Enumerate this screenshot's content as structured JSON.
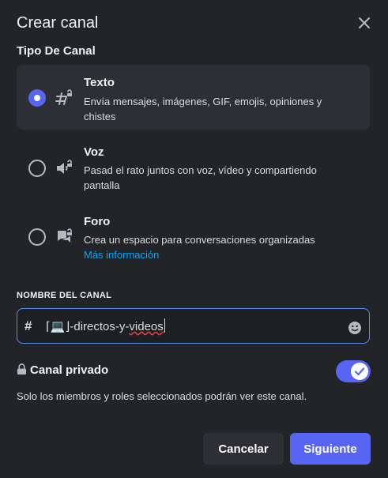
{
  "dialog": {
    "title": "Crear canal",
    "close_icon": "close-icon"
  },
  "channel_type": {
    "label": "Tipo De Canal",
    "selected": "Texto",
    "options": [
      {
        "name": "Texto",
        "description": "Envía mensajes, imágenes, GIF, emojis, opiniones y chistes",
        "icon": "text-channel-icon"
      },
      {
        "name": "Voz",
        "description": "Pasad el rato juntos con voz, vídeo y compartiendo pantalla",
        "icon": "voice-channel-icon"
      },
      {
        "name": "Foro",
        "description": "Crea un espacio para conversaciones organizadas",
        "link": "Más información",
        "icon": "forum-channel-icon"
      }
    ]
  },
  "channel_name": {
    "label": "NOMBRE DEL CANAL",
    "prefix": "#",
    "value_start": "⌈💻⌋-directos-y-",
    "value_misspelled": "videos"
  },
  "private": {
    "label": "Canal privado",
    "enabled": true,
    "description": "Solo los miembros y roles seleccionados podrán ver este canal."
  },
  "buttons": {
    "cancel": "Cancelar",
    "next": "Siguiente"
  },
  "colors": {
    "background": "#232428",
    "accent": "#5865f2",
    "link": "#00a8fc",
    "selected_bg": "#2e2f34"
  }
}
